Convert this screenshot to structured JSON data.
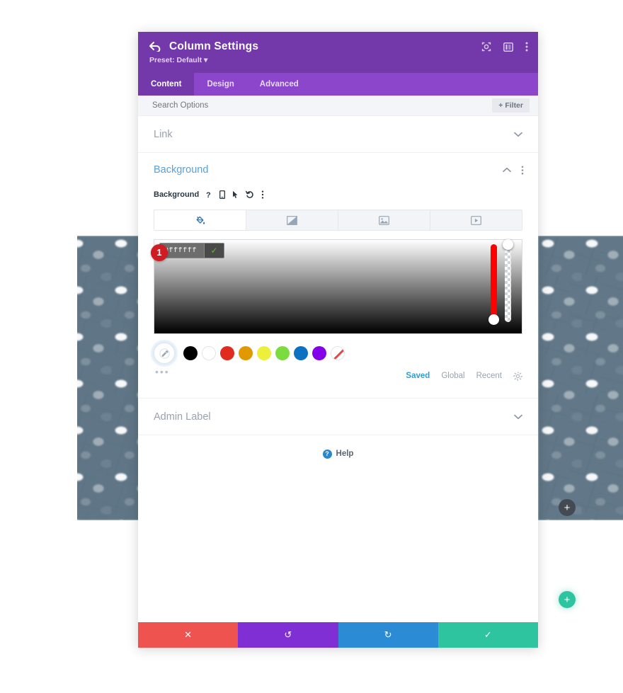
{
  "canvas": {
    "left_image_alt": "blue-grey mesh texture",
    "right_image_alt": "light blue-grey web texture",
    "add_module_button": "+",
    "add_row_button": "+"
  },
  "modal": {
    "back_icon": "back-arrow",
    "title": "Column Settings",
    "preset_label": "Preset: Default",
    "preset_caret": "▾",
    "header_actions": [
      {
        "name": "focus-target-icon",
        "title": "Focus"
      },
      {
        "name": "layout-columns-icon",
        "title": "Layout"
      },
      {
        "name": "vertical-dots-icon",
        "title": "More options"
      }
    ],
    "tabs": [
      {
        "label": "Content",
        "active": true
      },
      {
        "label": "Design",
        "active": false
      },
      {
        "label": "Advanced",
        "active": false
      }
    ],
    "search": {
      "placeholder": "Search Options",
      "value": ""
    },
    "filter_button": "+ Filter"
  },
  "sections": {
    "link": {
      "title": "Link",
      "expanded": false,
      "chevron": "⌄"
    },
    "background": {
      "title": "Background",
      "expanded": true,
      "collapse_chevron": "⌃",
      "more_icon": "vertical-dots-icon",
      "field_label": "Background",
      "field_icons": [
        {
          "name": "help-question-icon",
          "glyph": "?"
        },
        {
          "name": "responsive-mobile-icon",
          "glyph": "▯"
        },
        {
          "name": "hover-cursor-icon",
          "glyph": "➤"
        },
        {
          "name": "reset-undo-icon",
          "glyph": "↺"
        },
        {
          "name": "field-options-icon",
          "glyph": "⋮"
        }
      ],
      "type_tabs": [
        {
          "name": "background-color-tab",
          "icon": "paint-bucket-icon",
          "active": true
        },
        {
          "name": "background-gradient-tab",
          "icon": "gradient-icon",
          "active": false
        },
        {
          "name": "background-image-tab",
          "icon": "image-icon",
          "active": false
        },
        {
          "name": "background-video-tab",
          "icon": "video-icon",
          "active": false
        }
      ],
      "color_picker": {
        "hex_value": "#ffffff",
        "confirm_glyph": "✓",
        "step_badge": "1",
        "hue_color": "#ff0000",
        "hue_handle_position": "bottom",
        "alpha_handle_position": "top"
      },
      "swatches": [
        {
          "name": "eyedropper-swatch",
          "color": "",
          "icon": "eyedropper-icon"
        },
        {
          "name": "swatch-black",
          "color": "#000000"
        },
        {
          "name": "swatch-white",
          "color": "#ffffff"
        },
        {
          "name": "swatch-red",
          "color": "#e02b20"
        },
        {
          "name": "swatch-orange",
          "color": "#e09900"
        },
        {
          "name": "swatch-yellow",
          "color": "#edef3d"
        },
        {
          "name": "swatch-green",
          "color": "#7cdb3f"
        },
        {
          "name": "swatch-blue",
          "color": "#0c71c3"
        },
        {
          "name": "swatch-purple",
          "color": "#8300e9"
        },
        {
          "name": "swatch-transparent",
          "color": "none"
        }
      ],
      "more_swatches": "•••",
      "palette_tabs": [
        {
          "label": "Saved",
          "active": true
        },
        {
          "label": "Global",
          "active": false
        },
        {
          "label": "Recent",
          "active": false
        }
      ],
      "palette_settings_icon": "gear-icon"
    },
    "admin_label": {
      "title": "Admin Label",
      "expanded": false,
      "chevron": "⌄"
    }
  },
  "help": {
    "label": "Help",
    "icon_glyph": "?"
  },
  "footer_buttons": [
    {
      "name": "cancel-button",
      "glyph": "✕",
      "color": "#ef5350"
    },
    {
      "name": "undo-button",
      "glyph": "↺",
      "color": "#7f2fd4"
    },
    {
      "name": "redo-button",
      "glyph": "↻",
      "color": "#2b8bd4"
    },
    {
      "name": "save-button",
      "glyph": "✓",
      "color": "#2ec4a0"
    }
  ]
}
